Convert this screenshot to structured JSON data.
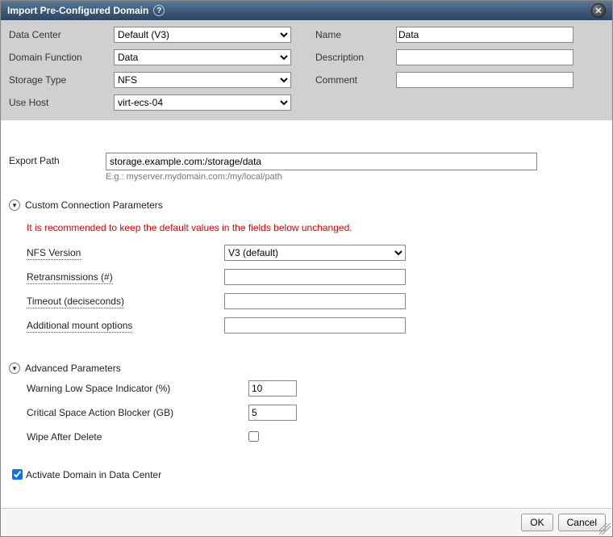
{
  "title": "Import Pre-Configured Domain",
  "top": {
    "data_center": {
      "label": "Data Center",
      "value": "Default (V3)"
    },
    "domain_function": {
      "label": "Domain Function",
      "value": "Data"
    },
    "storage_type": {
      "label": "Storage Type",
      "value": "NFS"
    },
    "use_host": {
      "label": "Use Host",
      "value": "virt-ecs-04"
    },
    "name": {
      "label": "Name",
      "value": "Data"
    },
    "description": {
      "label": "Description",
      "value": ""
    },
    "comment": {
      "label": "Comment",
      "value": ""
    }
  },
  "export": {
    "label": "Export Path",
    "value": "storage.example.com:/storage/data",
    "hint": "E.g.: myserver.mydomain.com:/my/local/path"
  },
  "custom": {
    "heading": "Custom Connection Parameters",
    "warning": "It is recommended to keep the default values in the fields below unchanged.",
    "nfs_version": {
      "label": "NFS Version",
      "value": "V3 (default)"
    },
    "retransmissions": {
      "label": "Retransmissions (#)",
      "value": ""
    },
    "timeout": {
      "label": "Timeout (deciseconds)",
      "value": ""
    },
    "mount_options": {
      "label": "Additional mount options",
      "value": ""
    }
  },
  "advanced": {
    "heading": "Advanced Parameters",
    "warning_low": {
      "label": "Warning Low Space Indicator (%)",
      "value": "10"
    },
    "critical": {
      "label": "Critical Space Action Blocker (GB)",
      "value": "5"
    },
    "wipe": {
      "label": "Wipe After Delete",
      "checked": false
    }
  },
  "activate": {
    "label": "Activate Domain in Data Center",
    "checked": true
  },
  "buttons": {
    "ok": "OK",
    "cancel": "Cancel"
  }
}
